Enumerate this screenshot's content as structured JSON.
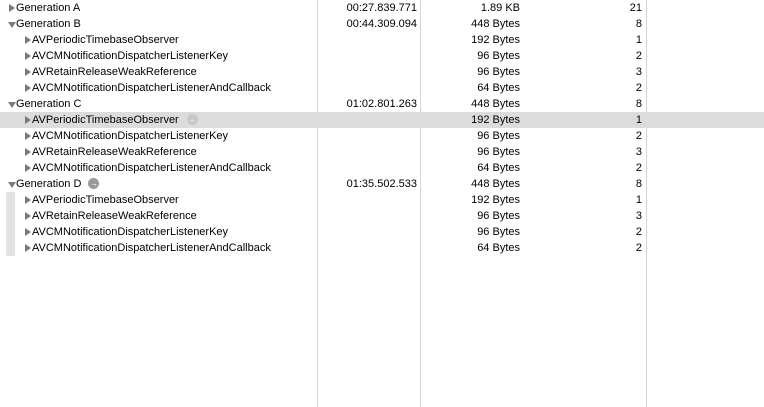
{
  "generations": [
    {
      "name": "Generation A",
      "timestamp": "00:27.839.771",
      "size": "1.89 KB",
      "count": "21",
      "expanded": false,
      "has_arrow": false,
      "children": []
    },
    {
      "name": "Generation B",
      "timestamp": "00:44.309.094",
      "size": "448 Bytes",
      "count": "8",
      "expanded": true,
      "has_arrow": false,
      "children": [
        {
          "name": "AVPeriodicTimebaseObserver",
          "size": "192 Bytes",
          "count": "1"
        },
        {
          "name": "AVCMNotificationDispatcherListenerKey",
          "size": "96 Bytes",
          "count": "2"
        },
        {
          "name": "AVRetainReleaseWeakReference",
          "size": "96 Bytes",
          "count": "3"
        },
        {
          "name": "AVCMNotificationDispatcherListenerAndCallback",
          "size": "64 Bytes",
          "count": "2"
        }
      ]
    },
    {
      "name": "Generation C",
      "timestamp": "01:02.801.263",
      "size": "448 Bytes",
      "count": "8",
      "expanded": true,
      "has_arrow": false,
      "children": [
        {
          "name": "AVPeriodicTimebaseObserver",
          "size": "192 Bytes",
          "count": "1",
          "selected": true,
          "has_arrow": true
        },
        {
          "name": "AVCMNotificationDispatcherListenerKey",
          "size": "96 Bytes",
          "count": "2"
        },
        {
          "name": "AVRetainReleaseWeakReference",
          "size": "96 Bytes",
          "count": "3"
        },
        {
          "name": "AVCMNotificationDispatcherListenerAndCallback",
          "size": "64 Bytes",
          "count": "2"
        }
      ]
    },
    {
      "name": "Generation D",
      "timestamp": "01:35.502.533",
      "size": "448 Bytes",
      "count": "8",
      "expanded": true,
      "has_arrow": true,
      "has_gutter": true,
      "children": [
        {
          "name": "AVPeriodicTimebaseObserver",
          "size": "192 Bytes",
          "count": "1"
        },
        {
          "name": "AVRetainReleaseWeakReference",
          "size": "96 Bytes",
          "count": "3"
        },
        {
          "name": "AVCMNotificationDispatcherListenerKey",
          "size": "96 Bytes",
          "count": "2"
        },
        {
          "name": "AVCMNotificationDispatcherListenerAndCallback",
          "size": "64 Bytes",
          "count": "2"
        }
      ]
    }
  ],
  "icons": {
    "disclosure_collapsed": "disclosure-triangle-right-icon",
    "disclosure_expanded": "disclosure-triangle-down-icon",
    "go_to": "go-to-arrow-icon"
  },
  "colors": {
    "selection": "#dcdcdc",
    "divider": "#d4d4d4",
    "triangle": "#7a7a7a"
  }
}
